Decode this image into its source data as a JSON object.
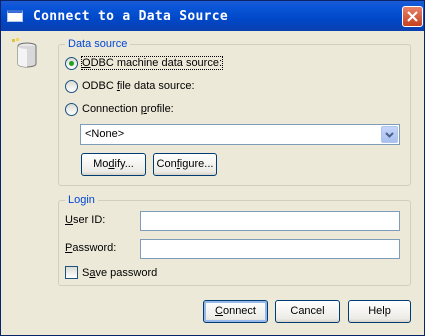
{
  "window": {
    "title": "Connect to a Data Source"
  },
  "data_source": {
    "legend": "Data source",
    "options": [
      {
        "label_pre": "",
        "label_key": "O",
        "label_post": "DBC machine data source:",
        "checked": true
      },
      {
        "label_pre": "ODBC ",
        "label_key": "f",
        "label_post": "ile data source:",
        "checked": false
      },
      {
        "label_pre": "Connection ",
        "label_key": "p",
        "label_post": "rofile:",
        "checked": false
      }
    ],
    "profile_select": {
      "value": "<None>"
    },
    "modify_button": {
      "pre": "Mo",
      "key": "d",
      "post": "ify..."
    },
    "configure_button": {
      "pre": "Con",
      "key": "f",
      "post": "igure..."
    }
  },
  "login": {
    "legend": "Login",
    "user_id": {
      "pre": "",
      "key": "U",
      "post": "ser ID:",
      "value": ""
    },
    "password": {
      "pre": "",
      "key": "P",
      "post": "assword:",
      "value": ""
    },
    "save_password": {
      "pre": "S",
      "key": "a",
      "post": "ve password",
      "checked": false
    }
  },
  "buttons": {
    "connect": {
      "pre": "",
      "key": "C",
      "post": "onnect"
    },
    "cancel": "Cancel",
    "help": "Help"
  }
}
